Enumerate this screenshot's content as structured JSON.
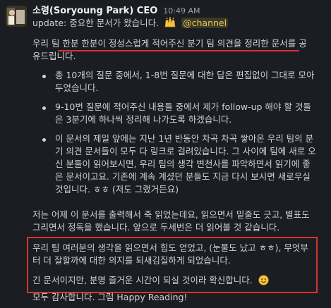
{
  "message": {
    "author": "소령(Soryoung Park) CEO",
    "time": "10:49 AM",
    "update_prefix": "update: 중요한 문서가 왔습니다.",
    "mention": "@channel",
    "intro_line1": "우리 팀 한분 한분이 정성스럽게 적어주신 분기 팀 의견을 정리한 문서를 공",
    "intro_line2": "유드립니다.",
    "bullets": [
      [
        "총 10개의 질문 중에서, 1-8번 질문에 대한 답은 편집없이 그대로 모아",
        "두었습니다."
      ],
      [
        "9-10번 질문에 적어주신 내용들 중에서 제가 follow-up 해야 할 것들",
        "은 3분기에 하나씩 정리해 나가도록 하겠습니다."
      ],
      [
        "이 문서의 제일 앞에는 지난 1년 반동안 차곡 차곡 쌓아온 우리 팀의 분",
        "기 의견 문서들이 모두 다 링크로 걸려있습니다. 그 사이에 팀에 새로 오",
        "신 분들이 읽어보시면, 우리 팀의 생각 변천사를 파악하면서 읽기에 좋",
        "은 문서이고요. 기존에 계속 계셨던 분들도 지금 다시 보시면 새로우실",
        "것입니다. ㅎㅎ (저도 그랬거든요)"
      ]
    ],
    "para_print": [
      "저는 어제 이 문서를 출력해서 죽 읽었는데요, 읽으면서 밑줄도 긋고, 별표도",
      "그리면서 정독을 했습니다. 앞으로 두세번은 더 읽어볼 것 같습니다."
    ],
    "highlight": [
      "우리 팀 여러분의 생각을 읽으면서 힘도 얻었고, (눈물도 났고 ㅎㅎ), 무엇부",
      "터 더 잘할까에 대한 의지를 되새김질하게 되었습니다.",
      "긴 문서이지만, 분명 즐거운 시간이 되실 것이라 확신합니다."
    ],
    "closing": "모두 감사합니다. 그럼 Happy Reading!"
  },
  "icons": {
    "raised_hands": "raised-hands-emoji",
    "smile": "smile-emoji",
    "avatar": "avatar-photo"
  },
  "colors": {
    "background": "#1a1d21",
    "mention_text": "#e8c767",
    "annotation_red": "#e0302f"
  }
}
